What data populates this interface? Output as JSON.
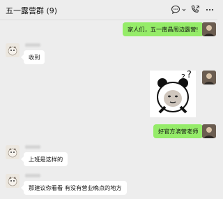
{
  "header": {
    "title": "五一露营群 (9)",
    "icons": [
      "chat-bubble-icon",
      "call-icon",
      "more-icon"
    ]
  },
  "messages": [
    {
      "side": "right",
      "type": "text",
      "text": "家人们，五一南昌周边露营!"
    },
    {
      "side": "left",
      "type": "text",
      "text": "收到"
    },
    {
      "side": "right",
      "type": "sticker",
      "sticker": "confused-panda-sticker"
    },
    {
      "side": "right",
      "type": "text",
      "text": "好官方滴营老师"
    },
    {
      "side": "left",
      "type": "text",
      "text": "上班是这样的"
    },
    {
      "side": "left",
      "type": "text",
      "text": "那建议你看看 有没有营业晚点的地方"
    }
  ],
  "colors": {
    "background": "#ededed",
    "bubble_self": "#95ec69",
    "bubble_other": "#ffffff"
  }
}
